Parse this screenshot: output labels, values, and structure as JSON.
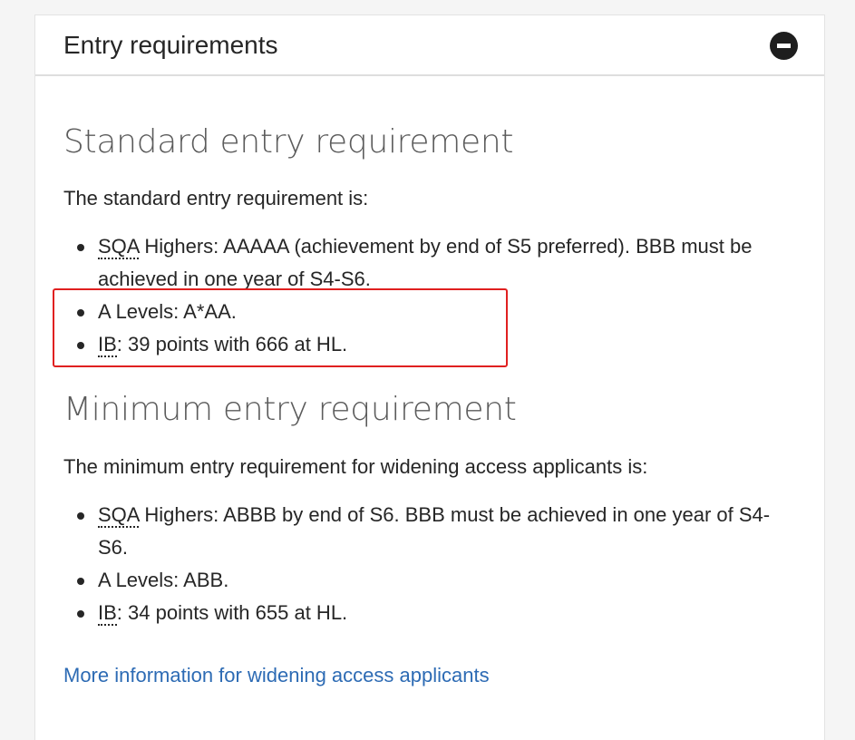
{
  "panel": {
    "title": "Entry requirements",
    "toggle_state": "expanded"
  },
  "standard": {
    "heading": "Standard entry requirement",
    "intro": "The standard entry requirement is:",
    "items": [
      {
        "abbr": "SQA",
        "text": " Highers: AAAAA (achievement by end of S5 preferred). BBB must be achieved in one year of S4-S6."
      },
      {
        "abbr": "",
        "text": "A Levels: A*AA."
      },
      {
        "abbr": "IB",
        "text": ": 39 points with 666 at HL."
      }
    ]
  },
  "minimum": {
    "heading": "Minimum entry requirement",
    "intro": "The minimum entry requirement for widening access applicants is:",
    "items": [
      {
        "abbr": "SQA",
        "text": " Highers: ABBB by end of S6. BBB must be achieved in one year of S4-S6."
      },
      {
        "abbr": "",
        "text": "A Levels: ABB."
      },
      {
        "abbr": "IB",
        "text": ": 34 points with 655 at HL."
      }
    ]
  },
  "link": {
    "label": "More information for widening access applicants"
  },
  "colors": {
    "link": "#2d6bb4",
    "highlight": "#e02020",
    "heading": "#5b5b5b"
  }
}
